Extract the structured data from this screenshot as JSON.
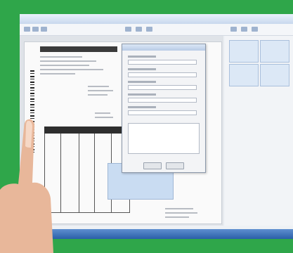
{
  "invoice": {
    "header": "",
    "has_barcode": true
  },
  "dialog": {
    "fields": 6
  },
  "colors": {
    "frame_border": "#2fa64a",
    "taskbar": "#2a5fa8",
    "invoice_header": "#3b3b3b",
    "selection_box": "#c9dcf2"
  },
  "icons": [
    "start-orb-icon"
  ]
}
